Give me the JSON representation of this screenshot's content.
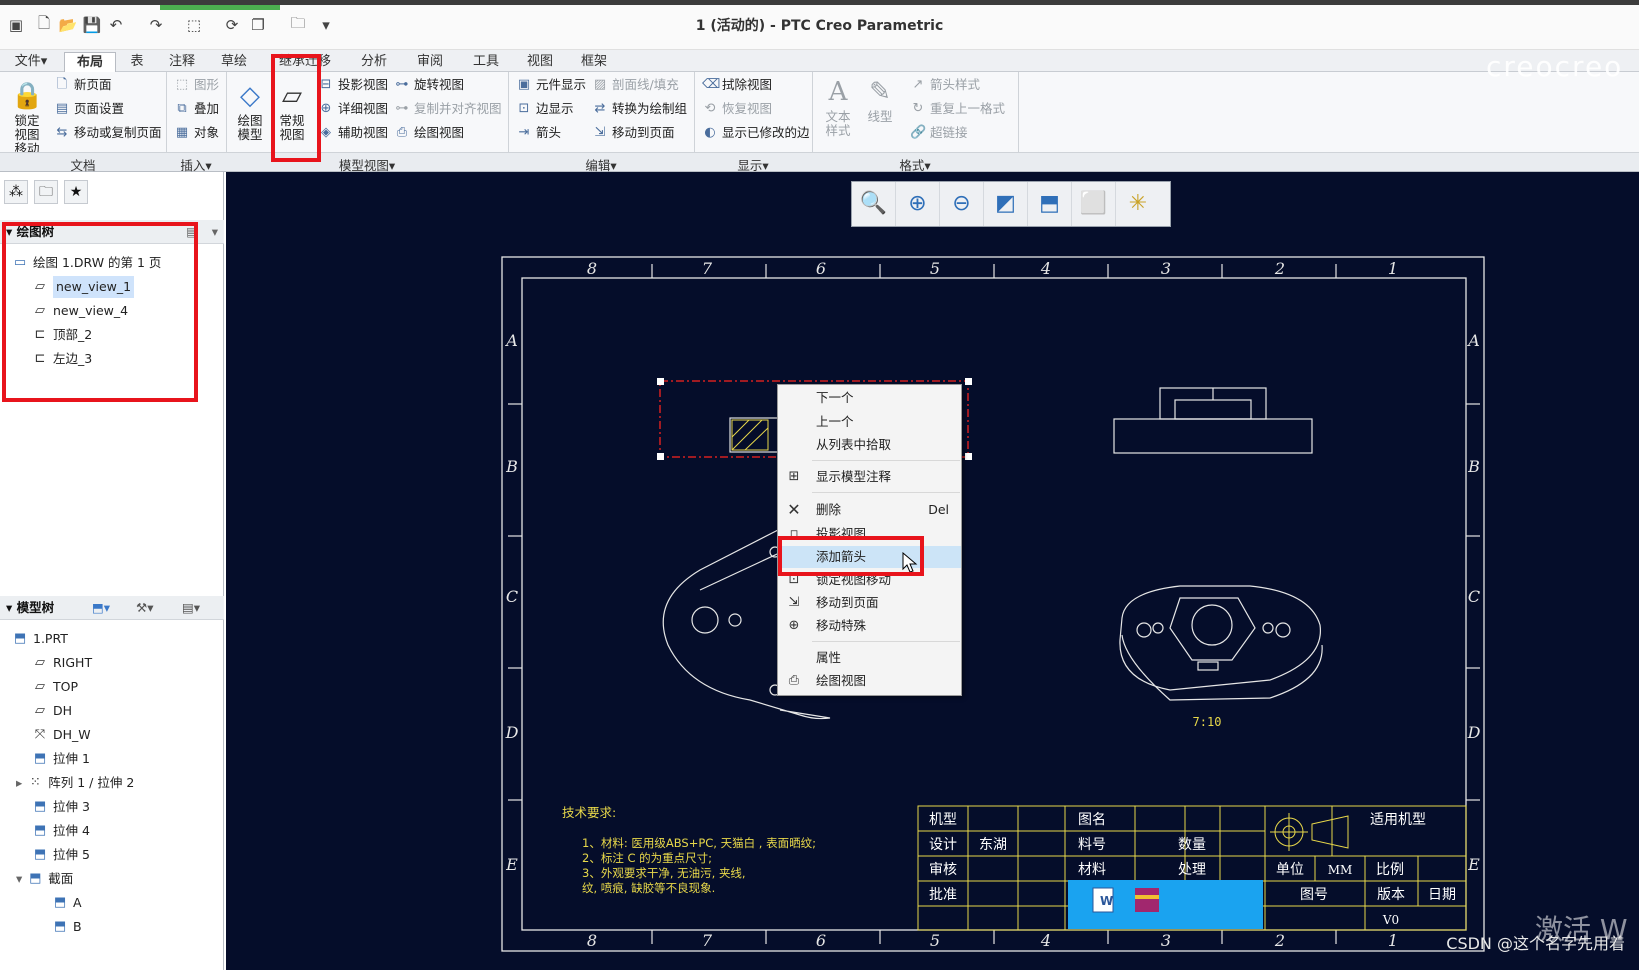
{
  "window": {
    "title": "1 (活动的) - PTC Creo Parametric"
  },
  "tabs": [
    "文件▾",
    "布局",
    "表",
    "注释",
    "草绘",
    "继承迁移",
    "分析",
    "审阅",
    "工具",
    "视图",
    "框架"
  ],
  "ribbon": {
    "lock_view_move": "锁定视图移动",
    "new_page": "新页面",
    "page_setup": "页面设置",
    "move_copy_page": "移动或复制页面",
    "graphics": "图形",
    "overlay": "叠加",
    "object": "对象",
    "drawing_model": "绘图模型",
    "general_view": "常规视图",
    "projection_view": "投影视图",
    "detail_view": "详细视图",
    "auxiliary_view": "辅助视图",
    "revolved_view": "旋转视图",
    "copy_align_view": "复制并对齐视图",
    "drawing_view": "绘图视图",
    "component_display": "元件显示",
    "edge_display": "边显示",
    "arrow": "箭头",
    "section_line_fill": "剖面线/填充",
    "convert_to_draft": "转换为绘制组",
    "move_to_page": "移动到页面",
    "erase_view": "拭除视图",
    "resume_view": "恢复视图",
    "show_modified_edges": "显示已修改的边",
    "text_style": "文本样式",
    "line_style": "线型",
    "arrow_style": "箭头样式",
    "repeat_format": "重复上一格式",
    "hyperlink": "超链接"
  },
  "groups": [
    "文档",
    "插入▾",
    "模型视图▾",
    "编辑▾",
    "显示▾",
    "格式▾"
  ],
  "drawing_tree": {
    "header": "绘图树",
    "items": [
      "绘图 1.DRW 的第 1 页",
      "new_view_1",
      "new_view_4",
      "顶部_2",
      "左边_3"
    ]
  },
  "model_tree": {
    "header": "模型树",
    "items": [
      "1.PRT",
      "RIGHT",
      "TOP",
      "DH",
      "DH_W",
      "拉伸 1",
      "阵列 1 / 拉伸 2",
      "拉伸 3",
      "拉伸 4",
      "拉伸 5",
      "截面",
      "A",
      "B"
    ]
  },
  "context_menu": {
    "items": [
      "下一个",
      "上一个",
      "从列表中拾取",
      "显示模型注释",
      "删除",
      "投影视图",
      "添加箭头",
      "锁定视图移动",
      "移动到页面",
      "移动特殊",
      "属性",
      "绘图视图"
    ],
    "delete_shortcut": "Del"
  },
  "drawing": {
    "col_numbers": [
      "8",
      "7",
      "6",
      "5",
      "4",
      "3",
      "2",
      "1"
    ],
    "row_letters": [
      "A",
      "B",
      "C",
      "D",
      "E"
    ],
    "scale_label": "7:10",
    "tech_title": "技术要求:",
    "tech_lines": [
      "1、材料: 医用级ABS+PC, 天猫白 , 表面晒纹;",
      "2、标注 C 的为重点尺寸;",
      "3、外观要求干净, 无油污, 夹线,",
      "   纹, 喷痕, 缺胶等不良现象."
    ],
    "title_block": {
      "model": "机型",
      "design": "设计",
      "designer": "东湖",
      "review": "审核",
      "approve": "批准",
      "drawing_name": "图名",
      "part_no": "料号",
      "material": "材料",
      "quantity": "数量",
      "treatment": "处理",
      "unit": "单位",
      "unit_value": "MM",
      "scale": "比例",
      "applicable": "适用机型",
      "drawing_no": "图号",
      "version": "版本",
      "date": "日期",
      "version_value": "V0"
    }
  },
  "watermark": "CSDN @这个名字先用着",
  "activation": "激活 W"
}
